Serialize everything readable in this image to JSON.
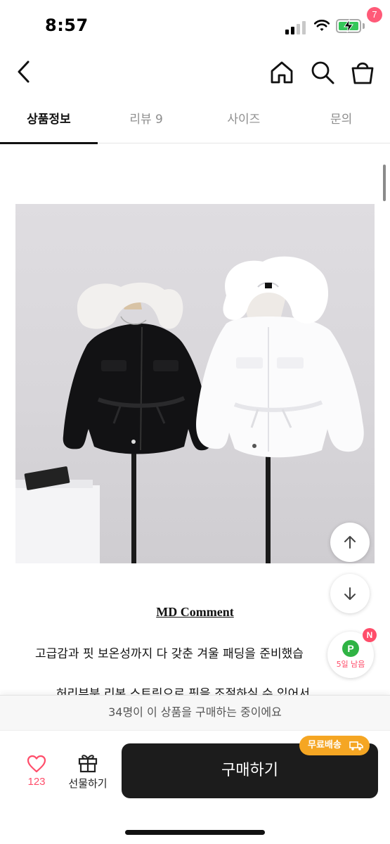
{
  "status_bar": {
    "time": "8:57"
  },
  "header": {
    "cart_count": "7"
  },
  "tabs": [
    {
      "label": "상품정보",
      "active": true
    },
    {
      "label": "리뷰 9",
      "active": false
    },
    {
      "label": "사이즈",
      "active": false
    },
    {
      "label": "문의",
      "active": false
    }
  ],
  "content": {
    "comment_title": "MD Comment",
    "description_line1": "고급감과 핏 보온성까지 다 갖춘 겨울 패딩을 준비했습",
    "description_line2": "허리부분 리본 스트링으로 핏을 조절하실 수 있어서"
  },
  "floating": {
    "point_letter": "P",
    "point_text": "5일 남음",
    "new_badge": "N"
  },
  "bottom": {
    "buyers_text": "34명이 이 상품을 구매하는 중이에요",
    "like_count": "123",
    "gift_label": "선물하기",
    "buy_label": "구매하기",
    "free_shipping_label": "무료배송"
  },
  "colors": {
    "accent_pink": "#ff4d6a",
    "buy_button": "#1c1c1c",
    "free_shipping": "#f5a623",
    "point_green": "#2fb344",
    "battery_green": "#35c759"
  },
  "icons": [
    "back-icon",
    "home-icon",
    "search-icon",
    "cart-icon",
    "arrow-up-icon",
    "arrow-down-icon",
    "heart-icon",
    "gift-icon",
    "truck-icon"
  ]
}
